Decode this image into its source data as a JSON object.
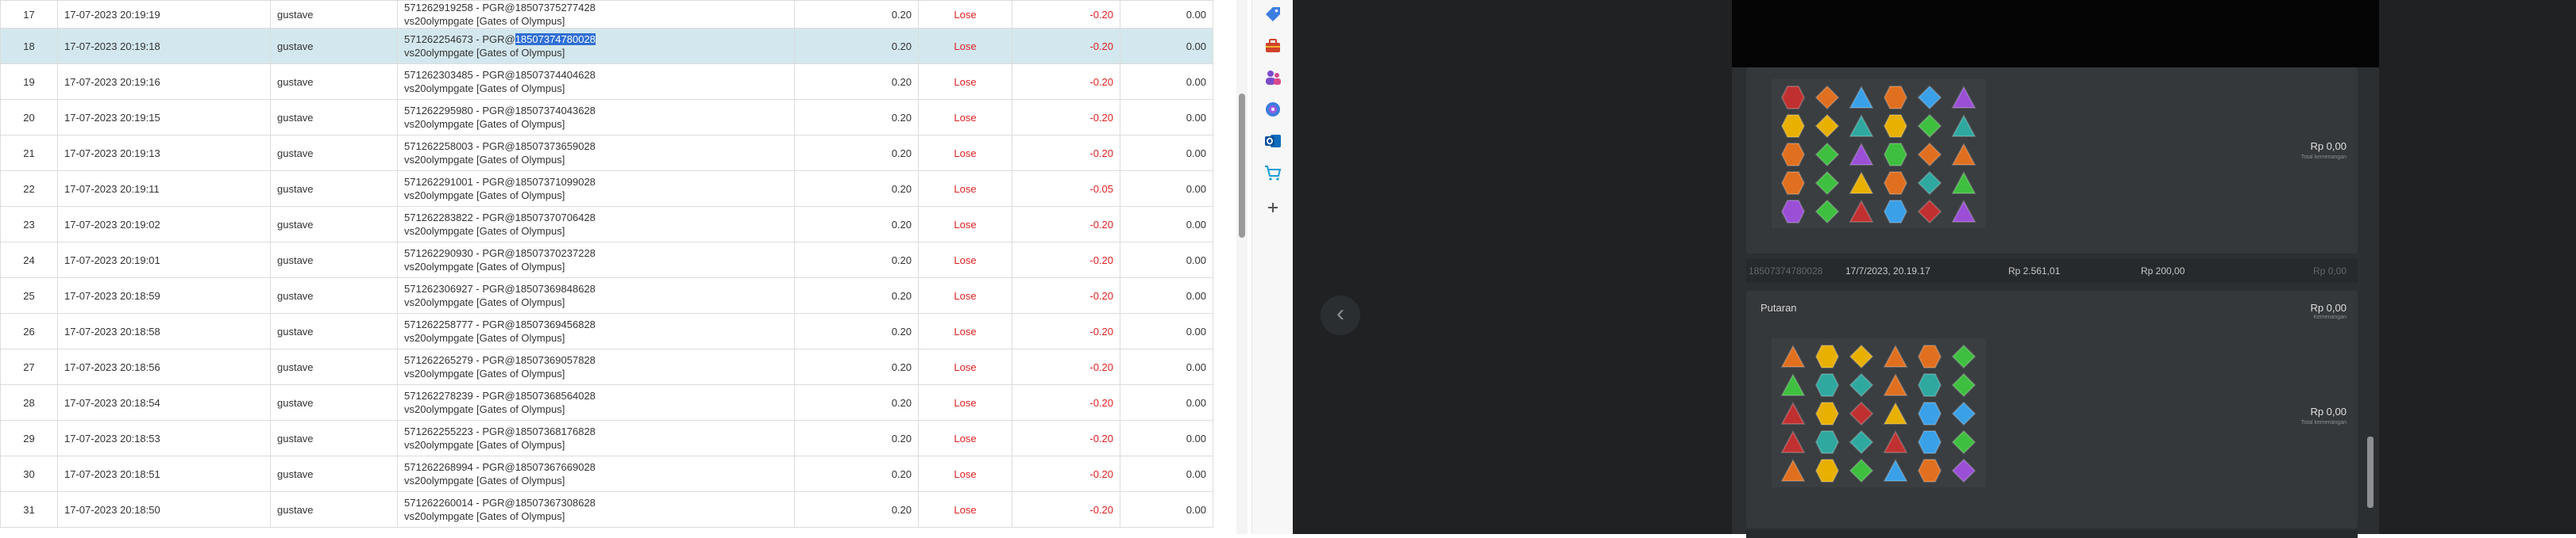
{
  "table": {
    "rows": [
      {
        "no": "17",
        "datetime": "17-07-2023 20:19:19",
        "user": "gustave",
        "game_line1": "571262919258 - PGR@18507375277428",
        "game_line2": "vs20olympgate [Gates of Olympus]",
        "bet": "0.20",
        "result": "Lose",
        "win_loss": "-0.20",
        "extra": "0.00"
      },
      {
        "no": "18",
        "datetime": "17-07-2023 20:19:18",
        "user": "gustave",
        "game_line1": "571262254673 - PGR@",
        "game_line1_highlight": "18507374780028",
        "game_line2": "vs20olympgate [Gates of Olympus]",
        "bet": "0.20",
        "result": "Lose",
        "win_loss": "-0.20",
        "extra": "0.00"
      },
      {
        "no": "19",
        "datetime": "17-07-2023 20:19:16",
        "user": "gustave",
        "game_line1": "571262303485 - PGR@18507374404628",
        "game_line2": "vs20olympgate [Gates of Olympus]",
        "bet": "0.20",
        "result": "Lose",
        "win_loss": "-0.20",
        "extra": "0.00"
      },
      {
        "no": "20",
        "datetime": "17-07-2023 20:19:15",
        "user": "gustave",
        "game_line1": "571262295980 - PGR@18507374043628",
        "game_line2": "vs20olympgate [Gates of Olympus]",
        "bet": "0.20",
        "result": "Lose",
        "win_loss": "-0.20",
        "extra": "0.00"
      },
      {
        "no": "21",
        "datetime": "17-07-2023 20:19:13",
        "user": "gustave",
        "game_line1": "571262258003 - PGR@18507373659028",
        "game_line2": "vs20olympgate [Gates of Olympus]",
        "bet": "0.20",
        "result": "Lose",
        "win_loss": "-0.20",
        "extra": "0.00"
      },
      {
        "no": "22",
        "datetime": "17-07-2023 20:19:11",
        "user": "gustave",
        "game_line1": "571262291001 - PGR@18507371099028",
        "game_line2": "vs20olympgate [Gates of Olympus]",
        "bet": "0.20",
        "result": "Lose",
        "win_loss": "-0.05",
        "extra": "0.00"
      },
      {
        "no": "23",
        "datetime": "17-07-2023 20:19:02",
        "user": "gustave",
        "game_line1": "571262283822 - PGR@18507370706428",
        "game_line2": "vs20olympgate [Gates of Olympus]",
        "bet": "0.20",
        "result": "Lose",
        "win_loss": "-0.20",
        "extra": "0.00"
      },
      {
        "no": "24",
        "datetime": "17-07-2023 20:19:01",
        "user": "gustave",
        "game_line1": "571262290930 - PGR@18507370237228",
        "game_line2": "vs20olympgate [Gates of Olympus]",
        "bet": "0.20",
        "result": "Lose",
        "win_loss": "-0.20",
        "extra": "0.00"
      },
      {
        "no": "25",
        "datetime": "17-07-2023 20:18:59",
        "user": "gustave",
        "game_line1": "571262306927 - PGR@18507369848628",
        "game_line2": "vs20olympgate [Gates of Olympus]",
        "bet": "0.20",
        "result": "Lose",
        "win_loss": "-0.20",
        "extra": "0.00"
      },
      {
        "no": "26",
        "datetime": "17-07-2023 20:18:58",
        "user": "gustave",
        "game_line1": "571262258777 - PGR@18507369456828",
        "game_line2": "vs20olympgate [Gates of Olympus]",
        "bet": "0.20",
        "result": "Lose",
        "win_loss": "-0.20",
        "extra": "0.00"
      },
      {
        "no": "27",
        "datetime": "17-07-2023 20:18:56",
        "user": "gustave",
        "game_line1": "571262265279 - PGR@18507369057828",
        "game_line2": "vs20olympgate [Gates of Olympus]",
        "bet": "0.20",
        "result": "Lose",
        "win_loss": "-0.20",
        "extra": "0.00"
      },
      {
        "no": "28",
        "datetime": "17-07-2023 20:18:54",
        "user": "gustave",
        "game_line1": "571262278239 - PGR@18507368564028",
        "game_line2": "vs20olympgate [Gates of Olympus]",
        "bet": "0.20",
        "result": "Lose",
        "win_loss": "-0.20",
        "extra": "0.00"
      },
      {
        "no": "29",
        "datetime": "17-07-2023 20:18:53",
        "user": "gustave",
        "game_line1": "571262255223 - PGR@18507368176828",
        "game_line2": "vs20olympgate [Gates of Olympus]",
        "bet": "0.20",
        "result": "Lose",
        "win_loss": "-0.20",
        "extra": "0.00"
      },
      {
        "no": "30",
        "datetime": "17-07-2023 20:18:51",
        "user": "gustave",
        "game_line1": "571262268994 - PGR@18507367669028",
        "game_line2": "vs20olympgate [Gates of Olympus]",
        "bet": "0.20",
        "result": "Lose",
        "win_loss": "-0.20",
        "extra": "0.00"
      },
      {
        "no": "31",
        "datetime": "17-07-2023 20:18:50",
        "user": "gustave",
        "game_line1": "571262260014 - PGR@18507367308628",
        "game_line2": "vs20olympgate [Gates of Olympus]",
        "bet": "0.20",
        "result": "Lose",
        "win_loss": "-0.20",
        "extra": "0.00"
      }
    ],
    "colors": {
      "negative": "#e02020",
      "selected_row": "#d3e8ee",
      "highlight": "#2f6fd6"
    }
  },
  "side_dock": {
    "icons": [
      "tag-icon",
      "toolbox-icon",
      "people-icon",
      "copilot-icon",
      "outlook-icon",
      "shopping-cart-icon",
      "add-icon"
    ]
  },
  "game_history": {
    "card1": {
      "amount": "Rp 0,00",
      "amount_sub": "Total kemenangan",
      "meta": {
        "id": "18507374780028",
        "time": "17/7/2023, 20.19.17",
        "balance": "Rp 2.561,01",
        "bet": "Rp 200,00",
        "win": "Rp 0,00"
      }
    },
    "card2": {
      "label": "Putaran",
      "amount_top": "Rp 0,00",
      "amount_top_sub": "Kemenangan",
      "amount": "Rp 0,00",
      "amount_sub": "Total kemenangan"
    }
  }
}
